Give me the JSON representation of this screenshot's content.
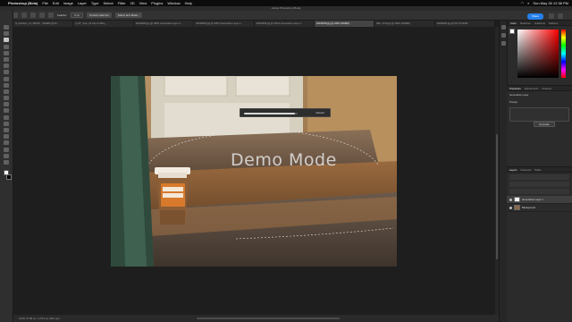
{
  "menubar": {
    "app_name": "Photoshop (Beta)",
    "items": [
      "File",
      "Edit",
      "Image",
      "Layer",
      "Type",
      "Select",
      "Filter",
      "3D",
      "View",
      "Plugins",
      "Window",
      "Help"
    ],
    "datetime": "Sun May 28 12:38 PM"
  },
  "titlebar": {
    "title": "Adobe Photoshop (Beta)"
  },
  "options": {
    "feather_label": "Feather:",
    "feather_value": "0 px",
    "style_label": "Style:",
    "style_value": "Normal",
    "ctx_button": "Context task bar",
    "select_mask": "Select and Mask...",
    "share_label": "Share"
  },
  "tabs": [
    "hi_Drunken_C1_00FHP...   (RGB/8) @ 52...",
    "(r)-27_June_24 Out of Office_...",
    "20230926.jpg @ 100% (Generative Layer 1...",
    "20230528.jpg @ 100% (Generative Layer 1...",
    "20230528.jpg @ 100% (Generative Layer 2...",
    "20230528.jpg @ 100% (RGB/8)...",
    "IMG_4720.jpg @ 100% (RGB/8)...",
    "20230926.jpg @ 66.7% (RGB..."
  ],
  "progress_dialog": {
    "value": 0.95,
    "cancel_label": "Cancel"
  },
  "canvas": {
    "overlay_text": "Demo Mode"
  },
  "right_panel": {
    "color_tabs": [
      "Color",
      "Swatches",
      "Gradients",
      "Patterns"
    ],
    "props_tabs": [
      "Properties",
      "Adjustments",
      "Libraries"
    ],
    "props_layer_label": "Generative Layer",
    "prompt_label": "Prompt",
    "generate_button": "Generate",
    "layers_tabs": [
      "Layers",
      "Channels",
      "Paths"
    ],
    "layers": [
      {
        "name": "Generative Layer 1",
        "active": true
      },
      {
        "name": "Background",
        "active": false
      }
    ]
  },
  "status": {
    "text": "100%   3708 px x 2764 px (300 ppi)"
  }
}
